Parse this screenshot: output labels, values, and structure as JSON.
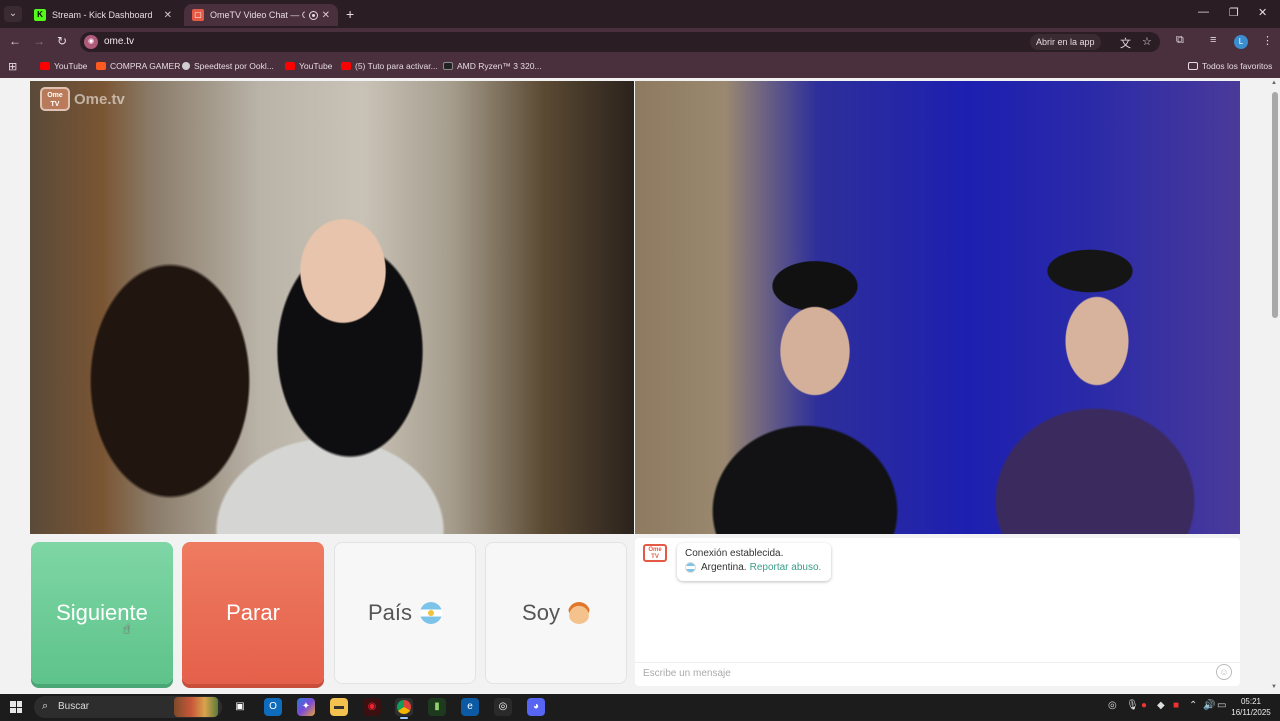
{
  "browser": {
    "tabs": [
      {
        "title": "Stream - Kick Dashboard",
        "favicon": "kick-icon",
        "active": false
      },
      {
        "title": "OmeTV Video Chat — Ome",
        "favicon": "ometv-icon",
        "active": true
      }
    ],
    "url": "ome.tv",
    "open_in_app": "Abrir en la app",
    "profile_initial": "L",
    "bookmarks": [
      {
        "label": "YouTube",
        "icon": "youtube-icon"
      },
      {
        "label": "COMPRA GAMER",
        "icon": "compragamer-icon"
      },
      {
        "label": "Speedtest por Ookl...",
        "icon": "speedtest-icon"
      },
      {
        "label": "YouTube",
        "icon": "youtube-icon"
      },
      {
        "label": "(5) Tuto para activar...",
        "icon": "youtube-icon"
      },
      {
        "label": "AMD Ryzen™ 3 320...",
        "icon": "amd-icon"
      }
    ],
    "all_bookmarks": "Todos los favoritos"
  },
  "page": {
    "logo_small": "Ome TV",
    "logo_text": "Ome.tv",
    "buttons": {
      "next": "Siguiente",
      "stop": "Parar",
      "country": "País",
      "gender": "Soy"
    },
    "chat": {
      "logo_small": "Ome TV",
      "status": "Conexión establecida.",
      "country": "Argentina.",
      "report": "Reportar abuso.",
      "input_placeholder": "Escribe un mensaje"
    }
  },
  "taskbar": {
    "search_label": "Buscar",
    "time": "05:21",
    "date": "16/11/2025"
  },
  "colors": {
    "next_button": "#6bcb95",
    "stop_button": "#e96a52",
    "report_link": "#3a9d8a",
    "browser_frame": "#4a2f3d"
  }
}
